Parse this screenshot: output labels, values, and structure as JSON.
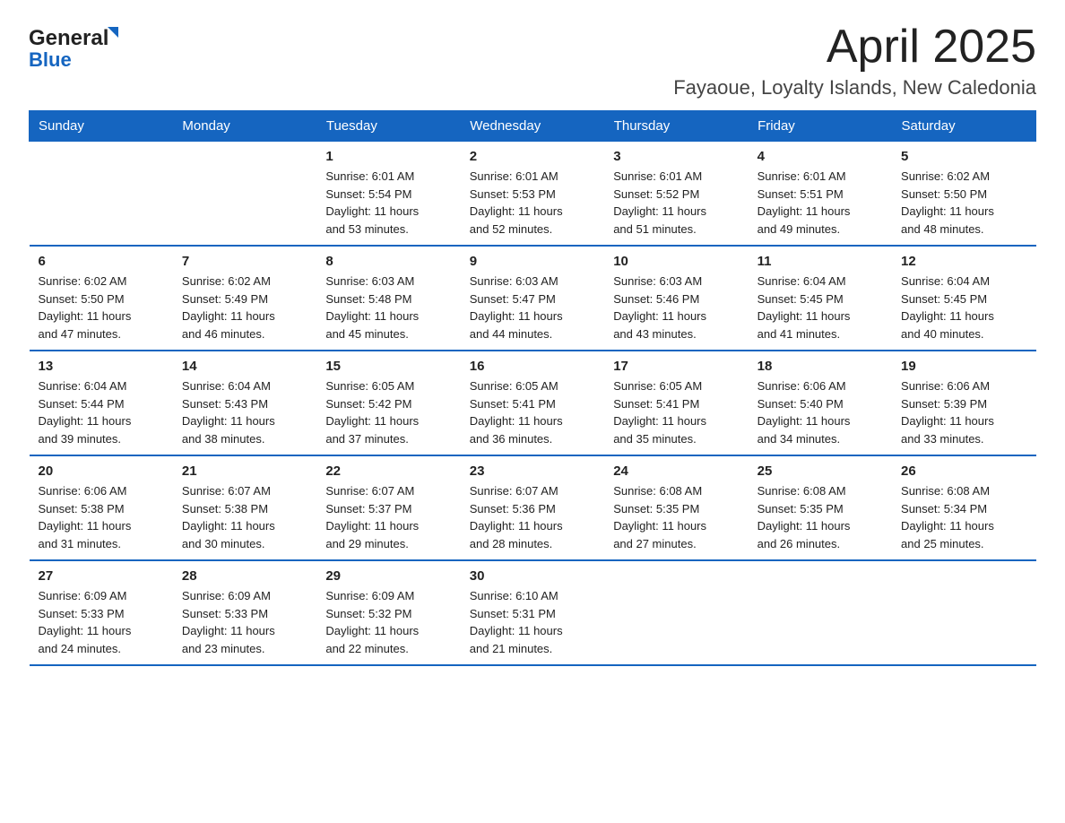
{
  "logo": {
    "text_general": "General",
    "text_blue": "Blue"
  },
  "header": {
    "title": "April 2025",
    "subtitle": "Fayaoue, Loyalty Islands, New Caledonia"
  },
  "columns": [
    "Sunday",
    "Monday",
    "Tuesday",
    "Wednesday",
    "Thursday",
    "Friday",
    "Saturday"
  ],
  "weeks": [
    [
      {
        "day": "",
        "info": ""
      },
      {
        "day": "",
        "info": ""
      },
      {
        "day": "1",
        "info": "Sunrise: 6:01 AM\nSunset: 5:54 PM\nDaylight: 11 hours\nand 53 minutes."
      },
      {
        "day": "2",
        "info": "Sunrise: 6:01 AM\nSunset: 5:53 PM\nDaylight: 11 hours\nand 52 minutes."
      },
      {
        "day": "3",
        "info": "Sunrise: 6:01 AM\nSunset: 5:52 PM\nDaylight: 11 hours\nand 51 minutes."
      },
      {
        "day": "4",
        "info": "Sunrise: 6:01 AM\nSunset: 5:51 PM\nDaylight: 11 hours\nand 49 minutes."
      },
      {
        "day": "5",
        "info": "Sunrise: 6:02 AM\nSunset: 5:50 PM\nDaylight: 11 hours\nand 48 minutes."
      }
    ],
    [
      {
        "day": "6",
        "info": "Sunrise: 6:02 AM\nSunset: 5:50 PM\nDaylight: 11 hours\nand 47 minutes."
      },
      {
        "day": "7",
        "info": "Sunrise: 6:02 AM\nSunset: 5:49 PM\nDaylight: 11 hours\nand 46 minutes."
      },
      {
        "day": "8",
        "info": "Sunrise: 6:03 AM\nSunset: 5:48 PM\nDaylight: 11 hours\nand 45 minutes."
      },
      {
        "day": "9",
        "info": "Sunrise: 6:03 AM\nSunset: 5:47 PM\nDaylight: 11 hours\nand 44 minutes."
      },
      {
        "day": "10",
        "info": "Sunrise: 6:03 AM\nSunset: 5:46 PM\nDaylight: 11 hours\nand 43 minutes."
      },
      {
        "day": "11",
        "info": "Sunrise: 6:04 AM\nSunset: 5:45 PM\nDaylight: 11 hours\nand 41 minutes."
      },
      {
        "day": "12",
        "info": "Sunrise: 6:04 AM\nSunset: 5:45 PM\nDaylight: 11 hours\nand 40 minutes."
      }
    ],
    [
      {
        "day": "13",
        "info": "Sunrise: 6:04 AM\nSunset: 5:44 PM\nDaylight: 11 hours\nand 39 minutes."
      },
      {
        "day": "14",
        "info": "Sunrise: 6:04 AM\nSunset: 5:43 PM\nDaylight: 11 hours\nand 38 minutes."
      },
      {
        "day": "15",
        "info": "Sunrise: 6:05 AM\nSunset: 5:42 PM\nDaylight: 11 hours\nand 37 minutes."
      },
      {
        "day": "16",
        "info": "Sunrise: 6:05 AM\nSunset: 5:41 PM\nDaylight: 11 hours\nand 36 minutes."
      },
      {
        "day": "17",
        "info": "Sunrise: 6:05 AM\nSunset: 5:41 PM\nDaylight: 11 hours\nand 35 minutes."
      },
      {
        "day": "18",
        "info": "Sunrise: 6:06 AM\nSunset: 5:40 PM\nDaylight: 11 hours\nand 34 minutes."
      },
      {
        "day": "19",
        "info": "Sunrise: 6:06 AM\nSunset: 5:39 PM\nDaylight: 11 hours\nand 33 minutes."
      }
    ],
    [
      {
        "day": "20",
        "info": "Sunrise: 6:06 AM\nSunset: 5:38 PM\nDaylight: 11 hours\nand 31 minutes."
      },
      {
        "day": "21",
        "info": "Sunrise: 6:07 AM\nSunset: 5:38 PM\nDaylight: 11 hours\nand 30 minutes."
      },
      {
        "day": "22",
        "info": "Sunrise: 6:07 AM\nSunset: 5:37 PM\nDaylight: 11 hours\nand 29 minutes."
      },
      {
        "day": "23",
        "info": "Sunrise: 6:07 AM\nSunset: 5:36 PM\nDaylight: 11 hours\nand 28 minutes."
      },
      {
        "day": "24",
        "info": "Sunrise: 6:08 AM\nSunset: 5:35 PM\nDaylight: 11 hours\nand 27 minutes."
      },
      {
        "day": "25",
        "info": "Sunrise: 6:08 AM\nSunset: 5:35 PM\nDaylight: 11 hours\nand 26 minutes."
      },
      {
        "day": "26",
        "info": "Sunrise: 6:08 AM\nSunset: 5:34 PM\nDaylight: 11 hours\nand 25 minutes."
      }
    ],
    [
      {
        "day": "27",
        "info": "Sunrise: 6:09 AM\nSunset: 5:33 PM\nDaylight: 11 hours\nand 24 minutes."
      },
      {
        "day": "28",
        "info": "Sunrise: 6:09 AM\nSunset: 5:33 PM\nDaylight: 11 hours\nand 23 minutes."
      },
      {
        "day": "29",
        "info": "Sunrise: 6:09 AM\nSunset: 5:32 PM\nDaylight: 11 hours\nand 22 minutes."
      },
      {
        "day": "30",
        "info": "Sunrise: 6:10 AM\nSunset: 5:31 PM\nDaylight: 11 hours\nand 21 minutes."
      },
      {
        "day": "",
        "info": ""
      },
      {
        "day": "",
        "info": ""
      },
      {
        "day": "",
        "info": ""
      }
    ]
  ]
}
